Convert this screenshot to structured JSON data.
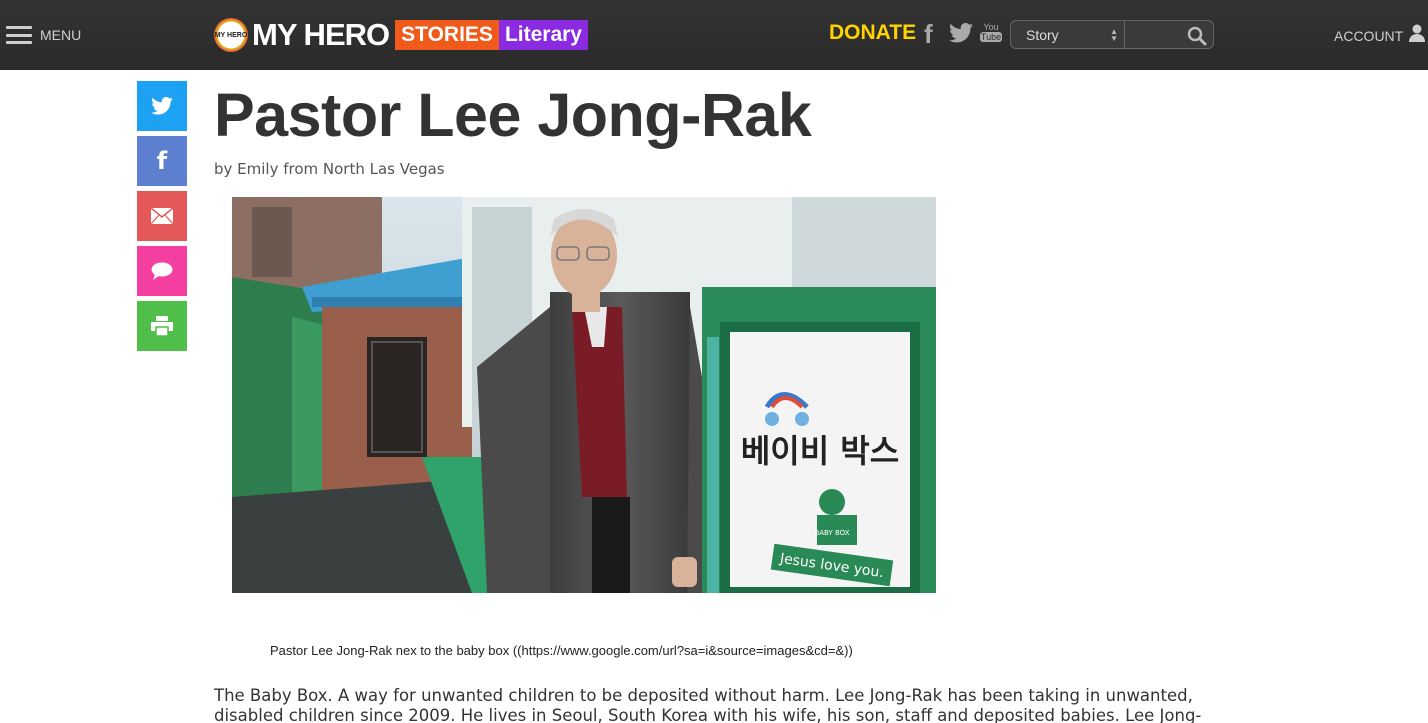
{
  "header": {
    "menu_label": "MENU",
    "logo": {
      "badge_text": "MY HERO",
      "brand": "MY HERO",
      "stories": "STORIES",
      "literary": "Literary"
    },
    "donate_label": "DONATE",
    "social": [
      "facebook-icon",
      "twitter-icon",
      "youtube-icon"
    ],
    "youtube_text": {
      "top": "You",
      "bottom": "Tube"
    },
    "search": {
      "selected": "Story",
      "value": ""
    },
    "account_label": "ACCOUNT"
  },
  "share_buttons": [
    {
      "name": "twitter",
      "color": "#1da1f2"
    },
    {
      "name": "facebook",
      "label": "f",
      "color": "#5d7fd0"
    },
    {
      "name": "email",
      "color": "#e4585a"
    },
    {
      "name": "comment",
      "color": "#f43ea0"
    },
    {
      "name": "print",
      "color": "#4fbf4a"
    }
  ],
  "article": {
    "title": "Pastor Lee Jong-Rak",
    "byline": "by Emily from North Las Vegas",
    "photo": {
      "sign_korean": "베이비 박스",
      "sign_tag": "Jesus love you.",
      "box_label": "BABY BOX"
    },
    "caption": "Pastor Lee Jong-Rak nex to the baby box ((https://www.google.com/url?sa=i&source=images&cd=&))",
    "body": "The Baby Box. A way for unwanted children to be deposited without harm. Lee Jong-Rak has been taking in unwanted, disabled children since 2009. He lives in Seoul, South Korea with his wife, his son, staff and deposited babies. Lee Jong-Rak has been saving"
  },
  "colors": {
    "topbar": "#2c2c2c",
    "donate": "#ffd200",
    "stories": "#f05a1a",
    "literary": "#8a2be2",
    "title": "#333333"
  }
}
